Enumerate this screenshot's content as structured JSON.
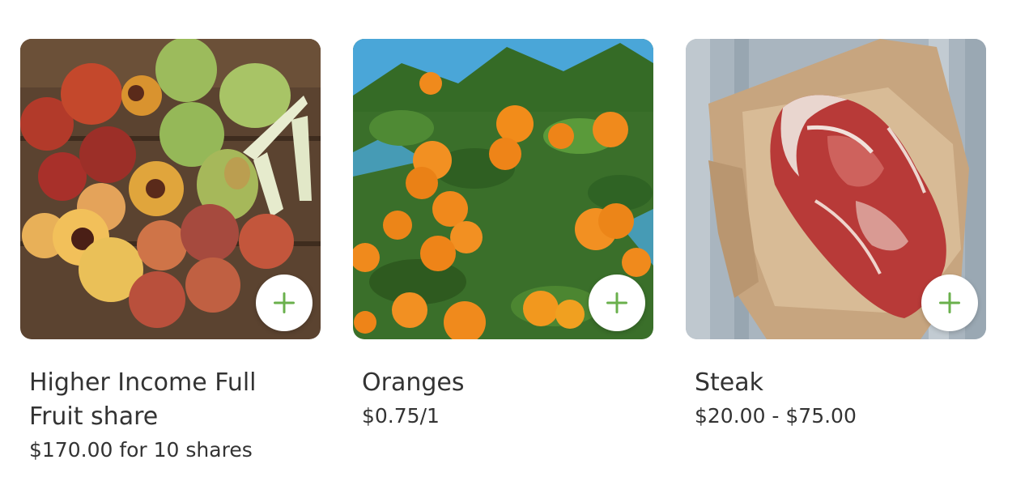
{
  "products": [
    {
      "title": "Higher Income Full Fruit share",
      "price": "$170.00 for 10 shares",
      "image": "peaches-and-pears-photo",
      "add_icon": "plus-icon"
    },
    {
      "title": "Oranges",
      "price": "$0.75/1",
      "image": "orange-tree-photo",
      "add_icon": "plus-icon"
    },
    {
      "title": "Steak",
      "price": "$20.00 - $75.00",
      "image": "raw-steak-on-paper-photo",
      "add_icon": "plus-icon"
    }
  ],
  "colors": {
    "accent": "#6ab04c",
    "text": "#333333",
    "background": "#ffffff"
  }
}
